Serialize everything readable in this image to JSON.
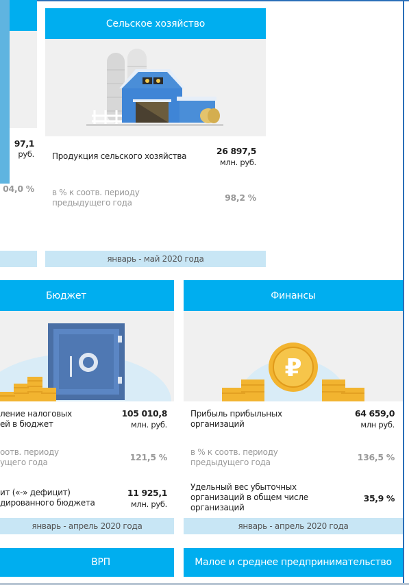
{
  "left_partial": {
    "value": "97,1",
    "unit": "руб.",
    "percent": "04,0 %"
  },
  "agriculture": {
    "title": "Сельское хозяйство",
    "label": "Продукция сельского хозяйства",
    "value": "26 897,5",
    "unit": "млн. руб.",
    "pct_label": "в % к соотв. периоду предыдущего года",
    "pct_value": "98,2 %",
    "period": "январь - май 2020 года"
  },
  "budget": {
    "title": "Бюджет",
    "row1_label": "ление налоговых\nей в бюджет",
    "row1_value": "105 010,8",
    "row1_unit": "млн. руб.",
    "row2_label": "оотв. периоду\nущего года",
    "row2_value": "121,5 %",
    "row3_label": "ит («-» дефицит)\nдированного бюджета",
    "row3_value": "11 925,1",
    "row3_unit": "млн. руб.",
    "period": "январь - апрель 2020 года"
  },
  "finance": {
    "title": "Финансы",
    "row1_label": "Прибыль прибыльных\nорганизаций",
    "row1_value": "64 659,0",
    "row1_unit": "млн руб.",
    "row2_label": "в % к соотв. периоду\nпредыдущего года",
    "row2_value": "136,5 %",
    "row3_label": "Удельный вес убыточных\nорганизаций в общем числе\nорганизаций",
    "row3_value": "35,9 %",
    "period": "январь - апрель 2020 года"
  },
  "nav": {
    "grp": "ВРП",
    "sme": "Малое и среднее предпринимательство"
  },
  "colors": {
    "header_blue": "#00aeef",
    "footer_blue": "#c8e6f5",
    "card_gray": "#f0f0f0"
  },
  "icons": {
    "agriculture": "barn-icon",
    "budget": "safe-with-coins-icon",
    "finance": "ruble-coin-icon"
  }
}
